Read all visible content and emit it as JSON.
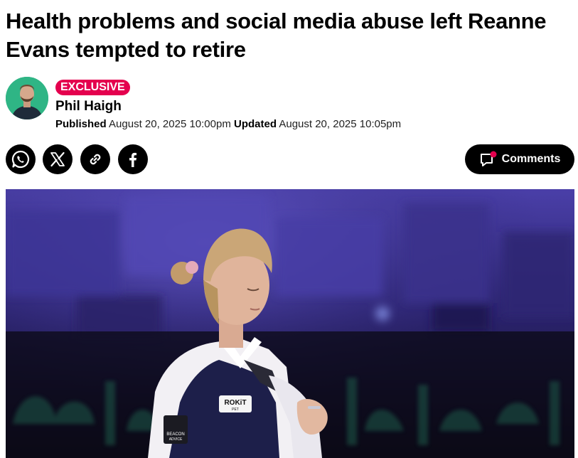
{
  "article": {
    "headline": "Health problems and social media abuse left Reanne Evans tempted to retire",
    "badge": "EXCLUSIVE",
    "author": "Phil Haigh",
    "published_label": "Published",
    "published_date": "August 20, 2025 10:00pm",
    "updated_label": "Updated",
    "updated_date": "August 20, 2025 10:05pm"
  },
  "share": {
    "icons": [
      "whatsapp-icon",
      "x-icon",
      "link-icon",
      "facebook-icon"
    ]
  },
  "comments": {
    "label": "Comments"
  },
  "hero": {
    "vest_logo": "ROKiT",
    "vest_logo_sub": "PET",
    "sleeve_patch": "BEACON",
    "sleeve_patch_sub": "ADVICE"
  },
  "colors": {
    "badge": "#e4004e",
    "avatar_bg": "#2fb585",
    "button_bg": "#000000",
    "notification_dot": "#e4004e"
  }
}
